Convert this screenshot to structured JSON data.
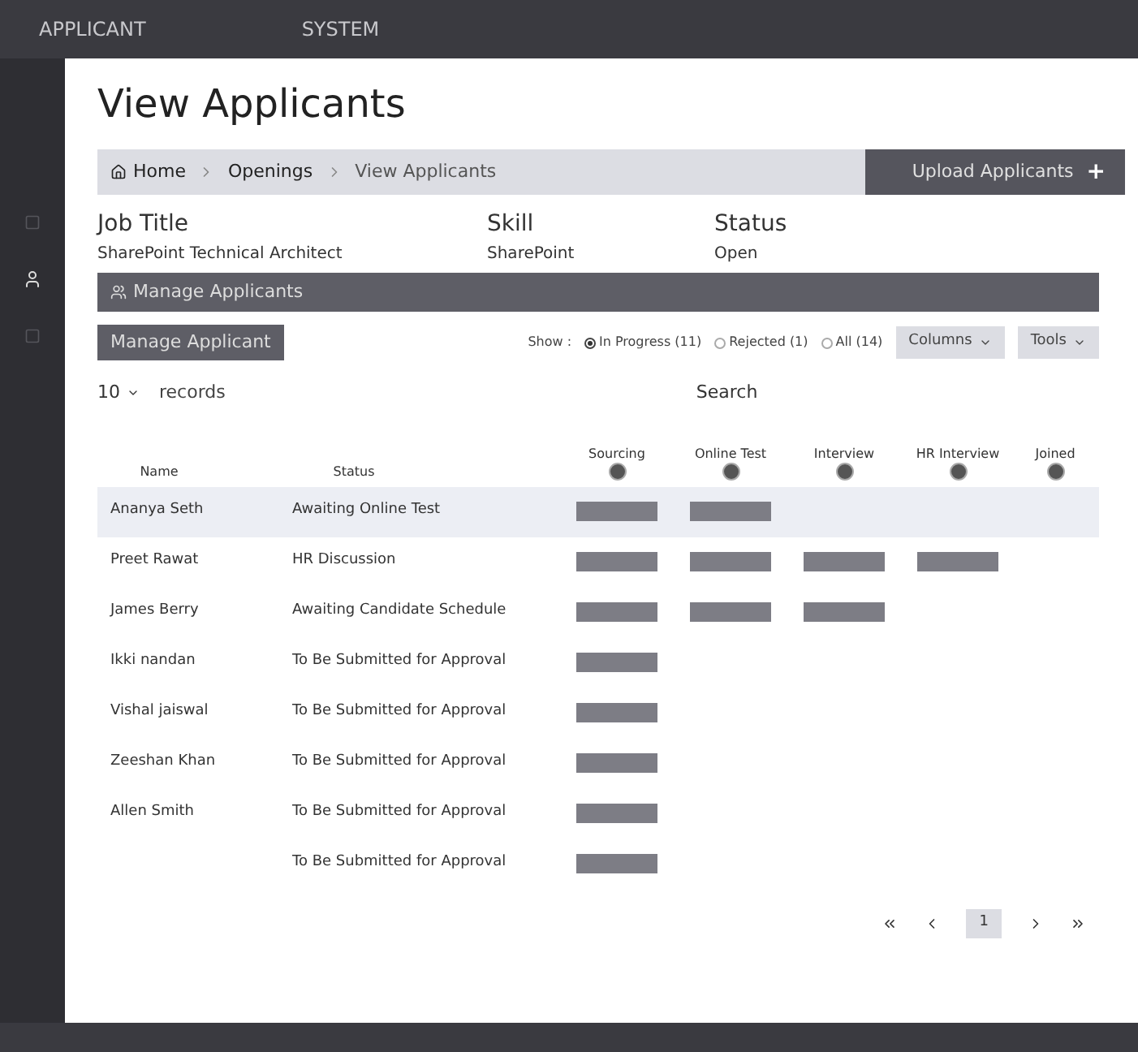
{
  "app_bar": {
    "title": "APPLICANT",
    "logo_text": "SYSTEM"
  },
  "page": {
    "title": "View Applicants"
  },
  "breadcrumb": [
    {
      "label": "Home",
      "kind": "home"
    },
    {
      "label": "Openings",
      "kind": "link"
    },
    {
      "label": "View Applicants",
      "kind": "current"
    }
  ],
  "upload_button": {
    "label": "Upload Applicants",
    "icon": "+"
  },
  "job_info": [
    {
      "label": "Job Title",
      "value": "SharePoint Technical Architect"
    },
    {
      "label": "Skill",
      "value": "SharePoint"
    },
    {
      "label": "Status",
      "value": "Open"
    }
  ],
  "panel": {
    "title": "Manage Applicants"
  },
  "manage_button": {
    "label": "Manage Applicant"
  },
  "filter": {
    "label": "Show :",
    "options": [
      {
        "label": "In Progress (11)",
        "selected": true
      },
      {
        "label": "Rejected (1)",
        "selected": false
      },
      {
        "label": "All (14)",
        "selected": false
      }
    ]
  },
  "tool_buttons": [
    {
      "label": "Columns"
    },
    {
      "label": "Tools"
    }
  ],
  "page_size": {
    "value": "10",
    "label": "records"
  },
  "search": {
    "label": "Search"
  },
  "table": {
    "columns": [
      {
        "label": "Name",
        "kind": "text"
      },
      {
        "label": "Status",
        "kind": "text"
      },
      {
        "label": "Sourcing",
        "kind": "stage"
      },
      {
        "label": "Online Test",
        "kind": "stage"
      },
      {
        "label": "Interview",
        "kind": "stage"
      },
      {
        "label": "HR Interview",
        "kind": "stage"
      },
      {
        "label": "Joined",
        "kind": "stage"
      }
    ],
    "rows": [
      {
        "name": "Ananya Seth",
        "status": "Awaiting Online Test",
        "selected": true,
        "stages": [
          true,
          true,
          false,
          false,
          false
        ]
      },
      {
        "name": "Preet Rawat",
        "status": "HR Discussion",
        "selected": false,
        "stages": [
          true,
          true,
          true,
          true,
          false
        ]
      },
      {
        "name": "James Berry",
        "status": "Awaiting Candidate Schedule",
        "selected": false,
        "stages": [
          true,
          true,
          true,
          false,
          false
        ]
      },
      {
        "name": "Ikki nandan",
        "status": "To Be Submitted for Approval",
        "selected": false,
        "stages": [
          true,
          false,
          false,
          false,
          false
        ]
      },
      {
        "name": "Vishal jaiswal",
        "status": "To Be Submitted for Approval",
        "selected": false,
        "stages": [
          true,
          false,
          false,
          false,
          false
        ]
      },
      {
        "name": "Zeeshan Khan",
        "status": "To Be Submitted for Approval",
        "selected": false,
        "stages": [
          true,
          false,
          false,
          false,
          false
        ]
      },
      {
        "name": "Allen Smith",
        "status": "To Be Submitted for Approval",
        "selected": false,
        "stages": [
          true,
          false,
          false,
          false,
          false
        ]
      },
      {
        "status": "To Be Submitted for Approval",
        "selected": false,
        "stages": [
          true,
          false,
          false,
          false,
          false
        ]
      }
    ]
  },
  "pagination": {
    "pages": [
      {
        "label": "1",
        "selected": true
      }
    ]
  }
}
